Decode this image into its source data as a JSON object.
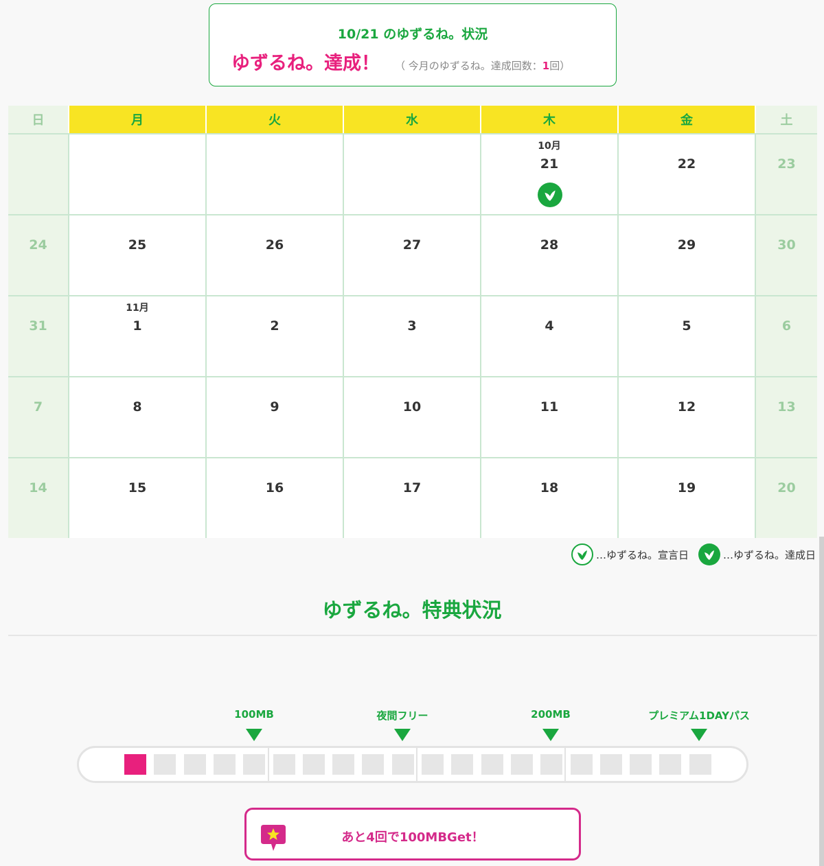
{
  "status": {
    "title": "10/21 のゆずるね。状況",
    "achieved": "ゆずるね。達成！",
    "count_prefix": "（ 今月のゆずるね。達成回数：",
    "count_value": "1",
    "count_suffix": "回）"
  },
  "calendar": {
    "weekdays": [
      "日",
      "月",
      "火",
      "水",
      "木",
      "金",
      "土"
    ],
    "weeks": [
      [
        {
          "day": ""
        },
        {
          "day": ""
        },
        {
          "day": ""
        },
        {
          "day": ""
        },
        {
          "day": "21",
          "month": "10月",
          "achieved": true
        },
        {
          "day": "22"
        },
        {
          "day": "23"
        }
      ],
      [
        {
          "day": "24"
        },
        {
          "day": "25"
        },
        {
          "day": "26"
        },
        {
          "day": "27"
        },
        {
          "day": "28"
        },
        {
          "day": "29"
        },
        {
          "day": "30"
        }
      ],
      [
        {
          "day": "31"
        },
        {
          "day": "1",
          "month": "11月"
        },
        {
          "day": "2"
        },
        {
          "day": "3"
        },
        {
          "day": "4"
        },
        {
          "day": "5"
        },
        {
          "day": "6"
        }
      ],
      [
        {
          "day": "7"
        },
        {
          "day": "8"
        },
        {
          "day": "9"
        },
        {
          "day": "10"
        },
        {
          "day": "11"
        },
        {
          "day": "12"
        },
        {
          "day": "13"
        }
      ],
      [
        {
          "day": "14"
        },
        {
          "day": "15"
        },
        {
          "day": "16"
        },
        {
          "day": "17"
        },
        {
          "day": "18"
        },
        {
          "day": "19"
        },
        {
          "day": "20"
        }
      ]
    ]
  },
  "legend": {
    "declared": "…ゆずるね。宣言日",
    "achieved": "…ゆずるね。達成日"
  },
  "benefits": {
    "title": "ゆずるね。特典状況",
    "milestones": [
      "100MB",
      "夜間フリー",
      "200MB",
      "プレミアム1DAYパス"
    ],
    "progress": {
      "filled": 1,
      "total": 20
    },
    "get_message": "あと4回で100MBGet！"
  },
  "colors": {
    "green": "#1aa73f",
    "pink": "#e8207d",
    "yellow": "#f8e423",
    "weekend_bg": "#ecf5e8"
  }
}
